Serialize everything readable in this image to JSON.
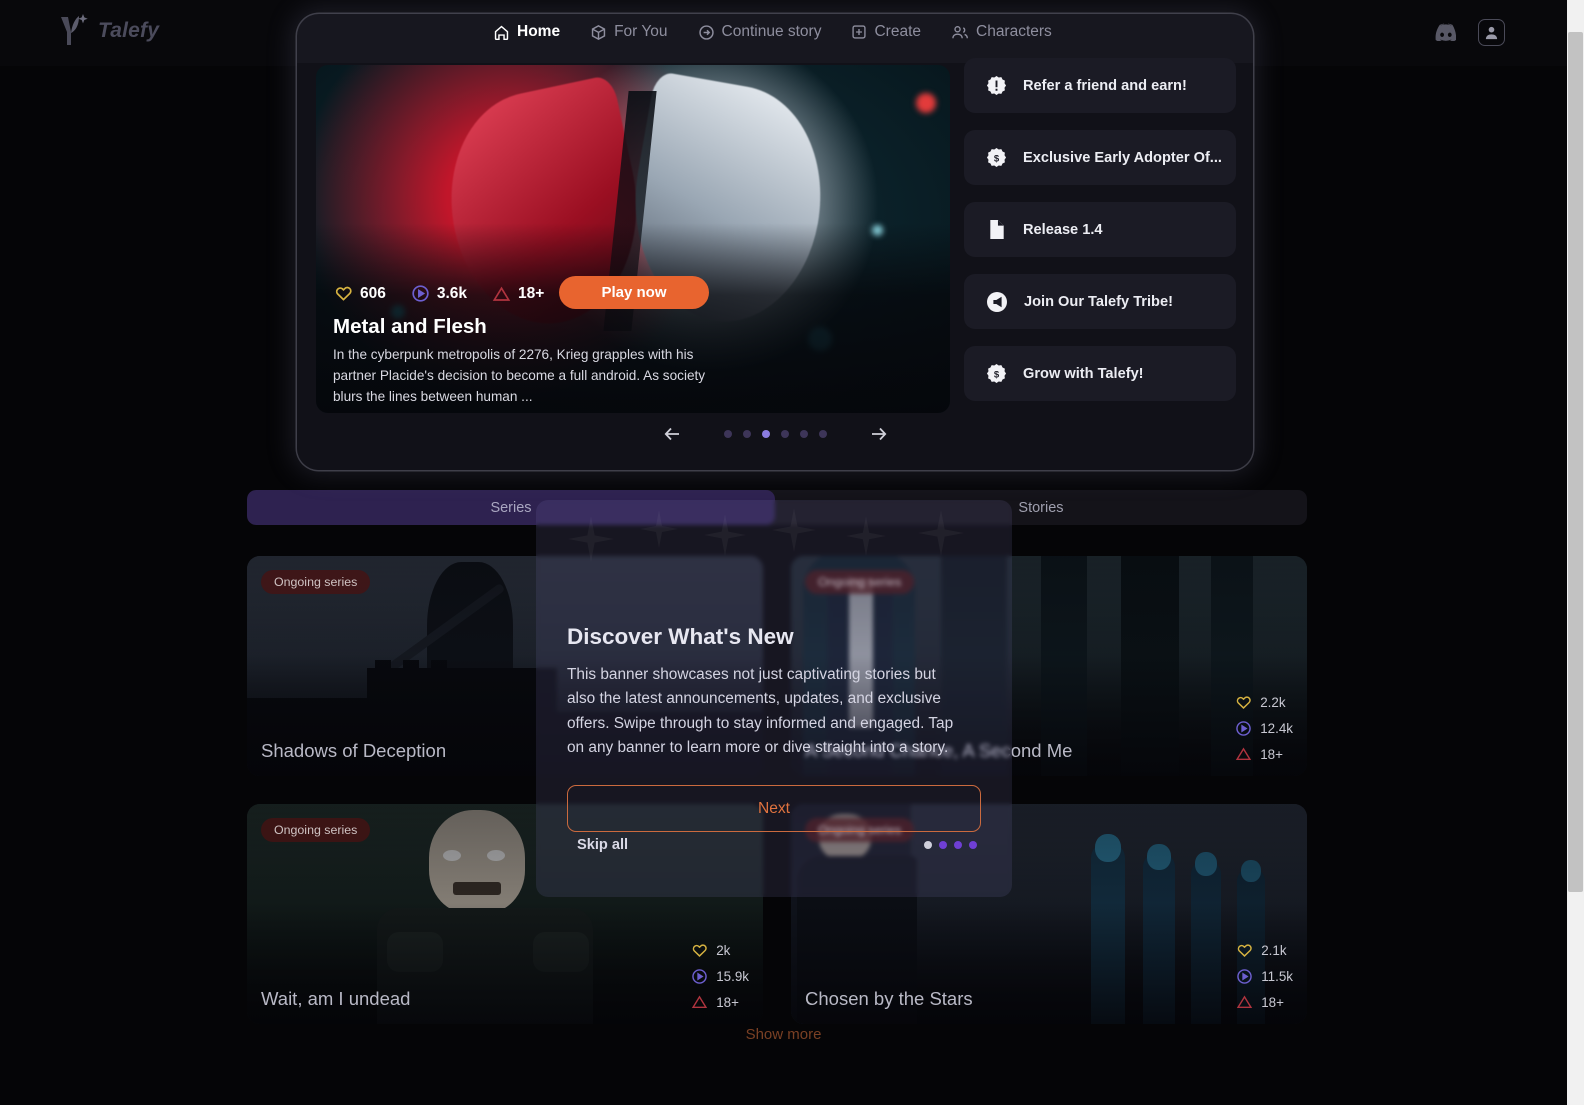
{
  "brand": {
    "name": "Talefy",
    "logo_icon": "talefy-leaf-sparkle-logo"
  },
  "nav": {
    "items": [
      {
        "label": "Home",
        "icon": "home-icon",
        "active": true
      },
      {
        "label": "For You",
        "icon": "dice-box-icon",
        "active": false
      },
      {
        "label": "Continue story",
        "icon": "arrow-right-circle-icon",
        "active": false
      },
      {
        "label": "Create",
        "icon": "plus-square-icon",
        "active": false
      },
      {
        "label": "Characters",
        "icon": "users-icon",
        "active": false
      }
    ]
  },
  "topright": {
    "discord_label": "discord-icon",
    "account_label": "account-avatar-icon"
  },
  "hero": {
    "title": "Metal and Flesh",
    "description": "In the cyberpunk metropolis of 2276, Krieg grapples with his partner Placide's decision to become a full android. As society blurs the lines between human ...",
    "likes": "606",
    "plays": "3.6k",
    "rating": "18+",
    "play_button": "Play now",
    "likes_icon": "heart-icon",
    "plays_icon": "play-circle-icon",
    "rating_icon": "warning-triangle-icon"
  },
  "carousel": {
    "prev_icon": "arrow-left-icon",
    "next_icon": "arrow-right-icon",
    "total_dots": 6,
    "active_dot": 3
  },
  "announcements": [
    {
      "label": "Refer a friend and earn!",
      "icon": "alert-badge-icon"
    },
    {
      "label": "Exclusive Early Adopter Of...",
      "icon": "dollar-badge-icon"
    },
    {
      "label": "Release 1.4",
      "icon": "document-icon"
    },
    {
      "label": "Join Our Talefy Tribe!",
      "icon": "megaphone-circle-icon"
    },
    {
      "label": "Grow with Talefy!",
      "icon": "dollar-badge-icon"
    }
  ],
  "tabs": [
    {
      "label": "Series",
      "active": true
    },
    {
      "label": "Stories",
      "active": false
    }
  ],
  "cards": [
    {
      "title": "Shadows of Deception",
      "badge": "Ongoing series",
      "likes": "",
      "plays": "",
      "rating": ""
    },
    {
      "title": "A Second Chance, A Second Me",
      "badge": "Ongoing series",
      "likes": "2.2k",
      "plays": "12.4k",
      "rating": "18+"
    },
    {
      "title": "Wait, am I undead",
      "badge": "Ongoing series",
      "likes": "2k",
      "plays": "15.9k",
      "rating": "18+"
    },
    {
      "title": "Chosen by the Stars",
      "badge": "Ongoing series",
      "likes": "2.1k",
      "plays": "11.5k",
      "rating": "18+"
    }
  ],
  "show_more": "Show more",
  "coachmark": {
    "title": "Discover What's New",
    "body": "This banner showcases not just captivating stories but also the latest announcements, updates, and exclusive offers. Swipe through to stay informed and engaged. Tap on any banner to learn more or dive straight into a story.",
    "next_label": "Next",
    "skip_label": "Skip all",
    "total_steps": 4,
    "active_step": 1
  },
  "colors": {
    "accent_orange": "#e8642f",
    "accent_purple": "#6f3fd4",
    "tab_active_bg": "#2e2250",
    "like_yellow": "#d7b341",
    "play_purple": "#6d5fd0",
    "rating_red": "#b0343f",
    "page_bg": "#050507"
  }
}
